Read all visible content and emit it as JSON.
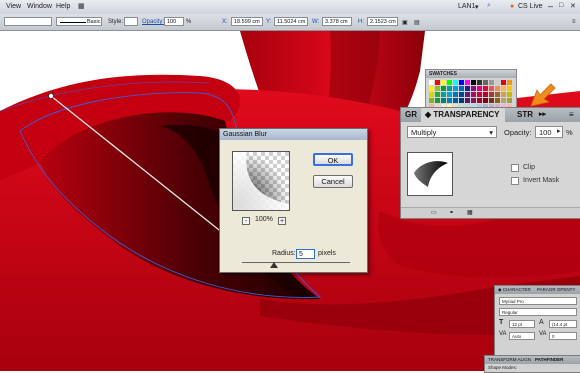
{
  "menubar": {
    "items": [
      "View",
      "Window",
      "Help"
    ],
    "workspace": "LAN1",
    "cs_live": "CS Live"
  },
  "controlbar": {
    "stroke_style": "Basic",
    "style_label": "Style:",
    "opacity_label": "Opacity:",
    "opacity_value": "100",
    "opacity_unit": "%",
    "x_label": "X:",
    "x_value": "18.599 cm",
    "y_label": "Y:",
    "y_value": "11.5024 cm",
    "w_label": "W:",
    "w_value": "3.378 cm",
    "h_label": "H:",
    "h_value": "2.1523 cm"
  },
  "swatches": {
    "title": "SWATCHES",
    "colors": [
      "#ffffff",
      "#ff0000",
      "#ffff00",
      "#00ff00",
      "#00ffff",
      "#0000ff",
      "#ff00ff",
      "#000000",
      "#333333",
      "#666666",
      "#999999",
      "#cccccc",
      "#e60012",
      "#f39800",
      "#fff100",
      "#8fc31f",
      "#009944",
      "#009e96",
      "#00a0e9",
      "#0068b7",
      "#1d2088",
      "#920783",
      "#e4007f",
      "#e5004f",
      "#ea5550",
      "#f19149",
      "#f8b551",
      "#fcc800",
      "#cfdb00",
      "#22ac38",
      "#00a29a",
      "#00a7db",
      "#0075c2",
      "#00479d",
      "#601986",
      "#a40b5d",
      "#d7003a",
      "#b8002c",
      "#a5382f",
      "#a0602d",
      "#d3a243",
      "#c9ba00",
      "#7fb80e",
      "#1d953f",
      "#007f76",
      "#007fb8",
      "#005aa0",
      "#00367a",
      "#4d1a74",
      "#851659",
      "#ad0030",
      "#7f0019",
      "#6a3906",
      "#8f5c1c",
      "#bba367",
      "#a99e3c",
      "#f5b1aa",
      "#fad2bf",
      "#fde8c1",
      "#fff3b8",
      "#dfeac4",
      "#c7e2cf",
      "#b7ddda",
      "#b3dbf2",
      "#a9c9ea",
      "#aab4db",
      "#bfb2d7",
      "#d6b0d2",
      "#f1b6cd",
      "#f4b3c2"
    ]
  },
  "transparency": {
    "tab_left": "GR",
    "tab_active": "TRANSPARENCY",
    "tab_right": "STR",
    "blend_mode": "Multiply",
    "opacity_label": "Opacity:",
    "opacity_value": "100",
    "percent": "%",
    "clip_label": "Clip",
    "invert_label": "Invert Mask"
  },
  "gaussian_blur": {
    "title": "Gaussian Blur",
    "ok_label": "OK",
    "cancel_label": "Cancel",
    "zoom_value": "100%",
    "zoom_out": "-",
    "zoom_in": "+",
    "radius_label": "Radius:",
    "radius_value": "5",
    "radius_unit": "pixels"
  },
  "character_panel": {
    "tab_character": "◆ CHARACTER",
    "tab_paragraph": "PARAGR OPENTY",
    "font_family": "Myriad Pro",
    "font_style": "Regular",
    "font_size": "12 pt",
    "leading": "(14.4 pt",
    "kerning": "Auto",
    "tracking": "0"
  },
  "transform_panel": {
    "tab_transform": "TRANSFORM ALIGN",
    "tab_pathfinder": "PATHFINDER",
    "shape_modes": "Shape Modes:"
  },
  "colors": {
    "accent_arrow": "#f28a1e",
    "art_red": "#c8000f",
    "art_dark": "#2a0000"
  }
}
